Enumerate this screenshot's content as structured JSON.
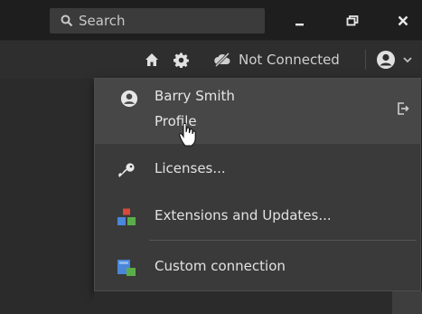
{
  "titlebar": {
    "search_placeholder": "Search",
    "minimize_icon": "minimize-icon",
    "restore_icon": "restore-icon",
    "close_icon": "close-icon"
  },
  "toolbar": {
    "home_icon": "home-icon",
    "settings_icon": "gear-icon",
    "connection_icon": "cloud-off-icon",
    "connection_status": "Not Connected",
    "user_icon": "user-icon",
    "user_dropdown_icon": "chevron-down-icon"
  },
  "menu": {
    "user_name": "Barry Smith",
    "profile_label": "Profile",
    "logout_icon": "sign-out-icon",
    "items": [
      {
        "label": "Licenses...",
        "icon": "key-icon"
      },
      {
        "label": "Extensions and Updates...",
        "icon": "extensions-icon"
      },
      {
        "label": "Custom connection",
        "icon": "custom-connection-icon"
      }
    ]
  },
  "colors": {
    "titlebar_bg": "#1e1e1e",
    "toolbar_bg": "#2e2e2e",
    "menu_bg": "#3a3a3a",
    "menu_highlight": "#474747",
    "extensions_red": "#d94a3a",
    "extensions_blue": "#4a86d9",
    "extensions_green": "#5aae4a"
  }
}
